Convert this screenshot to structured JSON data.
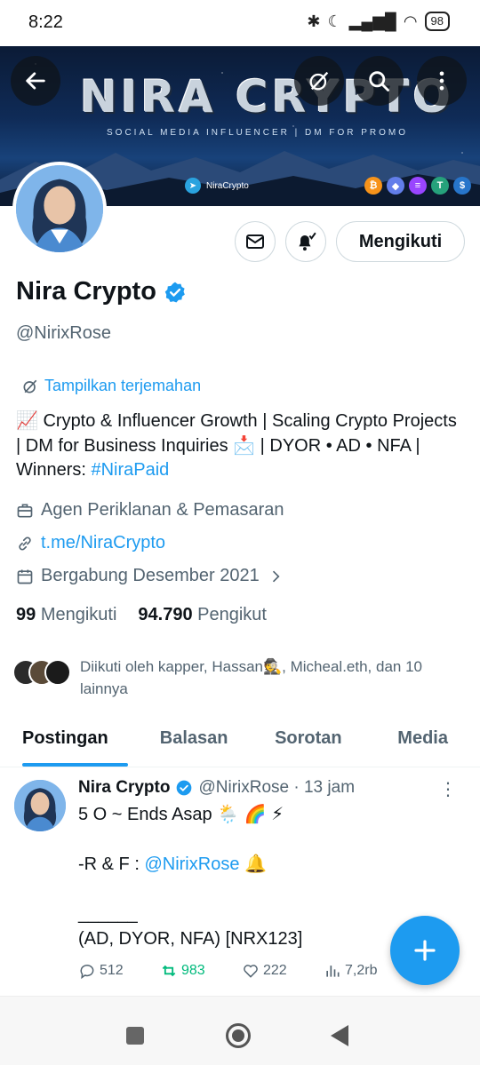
{
  "status_bar": {
    "time": "8:22",
    "battery": "98"
  },
  "banner": {
    "title": "NIRA CRYPTO",
    "subtitle": "SOCIAL MEDIA INFLUENCER | DM FOR PROMO",
    "telegram": "NiraCrypto",
    "coins": [
      {
        "icon": "bitcoin-icon",
        "glyph": "₿",
        "color": "#f7931a"
      },
      {
        "icon": "ethereum-icon",
        "glyph": "◆",
        "color": "#627eea"
      },
      {
        "icon": "solana-icon",
        "glyph": "≡",
        "color": "#9945ff"
      },
      {
        "icon": "tether-icon",
        "glyph": "T",
        "color": "#26a17b"
      },
      {
        "icon": "usdc-icon",
        "glyph": "$",
        "color": "#2775ca"
      }
    ]
  },
  "profile": {
    "name": "Nira Crypto",
    "handle": "@NirixRose",
    "translate": "Tampilkan terjemahan",
    "follow_label": "Mengikuti",
    "bio_main": "📈 Crypto & Influencer Growth | Scaling Crypto Projects | DM for Business Inquiries 📩 | DYOR • AD • NFA | Winners: ",
    "bio_hashtag": "#NiraPaid",
    "category": "Agen Periklanan & Pemasaran",
    "link": "t.me/NiraCrypto",
    "joined": "Bergabung Desember 2021",
    "following_count": "99",
    "following_label": "Mengikuti",
    "followers_count": "94.790",
    "followers_label": "Pengikut",
    "followed_by": "Diikuti oleh kapper, Hassan🕵️, Micheal.eth, dan 10 lainnya"
  },
  "tabs": [
    {
      "label": "Postingan"
    },
    {
      "label": "Balasan"
    },
    {
      "label": "Sorotan"
    },
    {
      "label": "Media"
    }
  ],
  "post": {
    "author": "Nira Crypto",
    "meta": "@NirixRose · 13 jam",
    "line1": "5 O ~ Ends Asap 🌦️ 🌈 ⚡",
    "line2_prefix": "-R & F : ",
    "line2_mention": "@NirixRose",
    "line2_suffix": " 🔔",
    "line3": "______",
    "line4": "(AD, DYOR, NFA) [NRX123]",
    "replies": "512",
    "reposts": "983",
    "likes": "222",
    "views": "7,2rb"
  },
  "colors": {
    "accent": "#1d9bf0",
    "repost": "#00ba7c",
    "muted": "#536471"
  }
}
